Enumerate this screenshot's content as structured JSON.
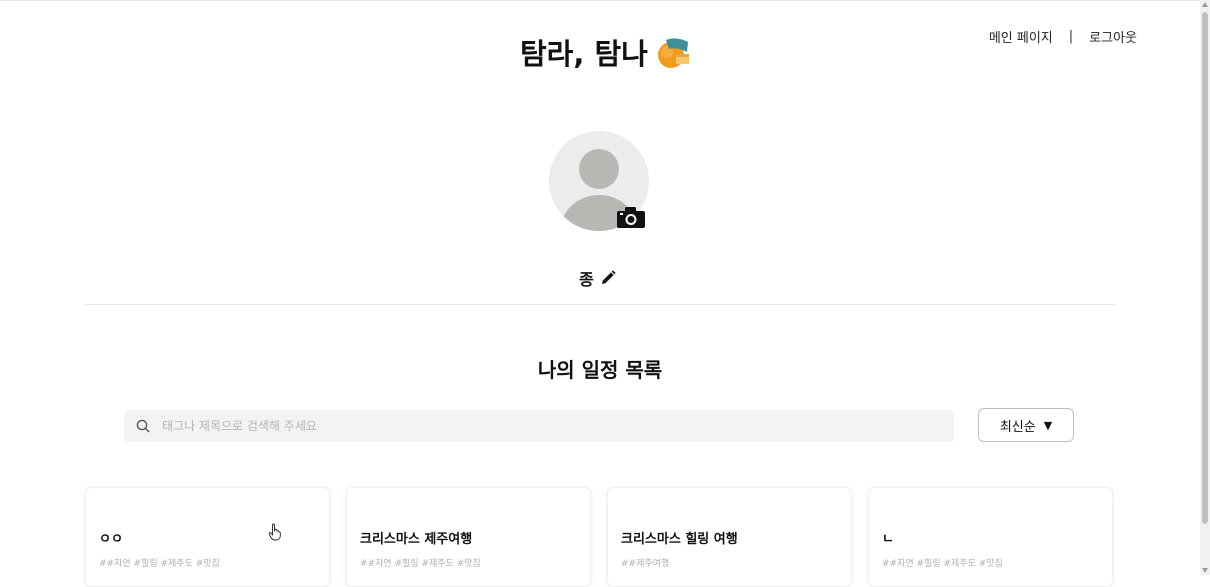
{
  "header": {
    "logo_text": "탐라, 탐나",
    "logo_icon": "tangerine-icon",
    "nav": {
      "main_page": "메인 페이지",
      "separator": "|",
      "logout": "로그아웃"
    }
  },
  "profile": {
    "avatar_icon": "default-avatar-icon",
    "camera_icon": "camera-icon",
    "nickname": "종",
    "edit_icon": "pencil-icon"
  },
  "schedules": {
    "title": "나의 일정 목록",
    "search_placeholder": "태그나 제목으로 검색해 주세요",
    "search_value": "",
    "sort_label": "최신순",
    "sort_arrow": "▼",
    "cards": [
      {
        "title": "ㅇㅇ",
        "tags": "##자연 #힐링 #제주도 #맛집"
      },
      {
        "title": "크리스마스 제주여행",
        "tags": "##자연 #힐링 #제주도 #맛집"
      },
      {
        "title": "크리스마스 힐링 여행",
        "tags": "##제주여행"
      },
      {
        "title": "ㄴ",
        "tags": "##자연 #힐링 #제주도 #맛집"
      }
    ]
  },
  "colors": {
    "background": "#ffffff",
    "search_bg": "#f3f3f3",
    "tag_text": "#b0b0b0",
    "avatar_bg": "#ececec",
    "avatar_fg": "#b9b7b4"
  }
}
